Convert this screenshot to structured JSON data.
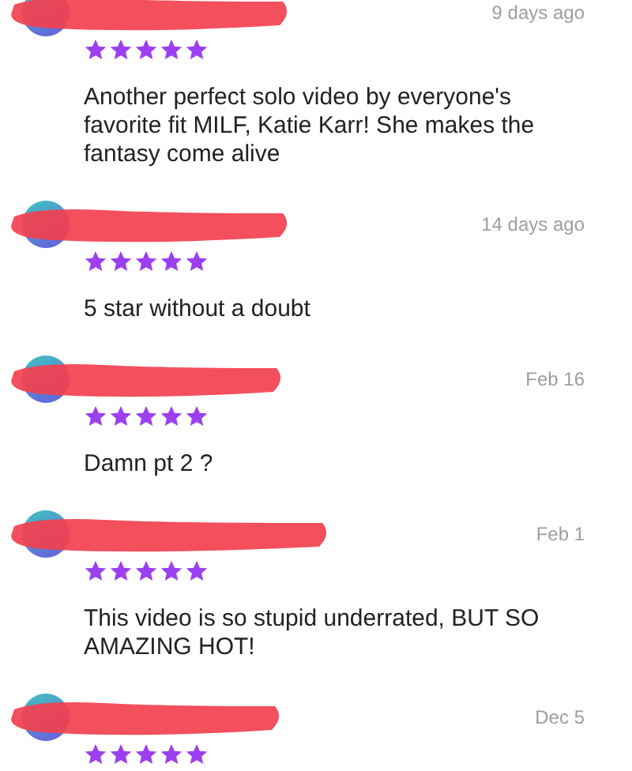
{
  "reviews": [
    {
      "date": "9 days ago",
      "stars": 5,
      "text": "Another perfect solo video by everyone's favorite fit MILF, Katie Karr! She makes the fantasy come alive"
    },
    {
      "date": "14 days ago",
      "stars": 5,
      "text": "5 star without a doubt"
    },
    {
      "date": "Feb 16",
      "stars": 5,
      "text": "Damn pt 2 ?"
    },
    {
      "date": "Feb 1",
      "stars": 5,
      "text": "This video is so stupid underrated, BUT SO AMAZING HOT!"
    },
    {
      "date": "Dec 5",
      "stars": 5
    }
  ]
}
